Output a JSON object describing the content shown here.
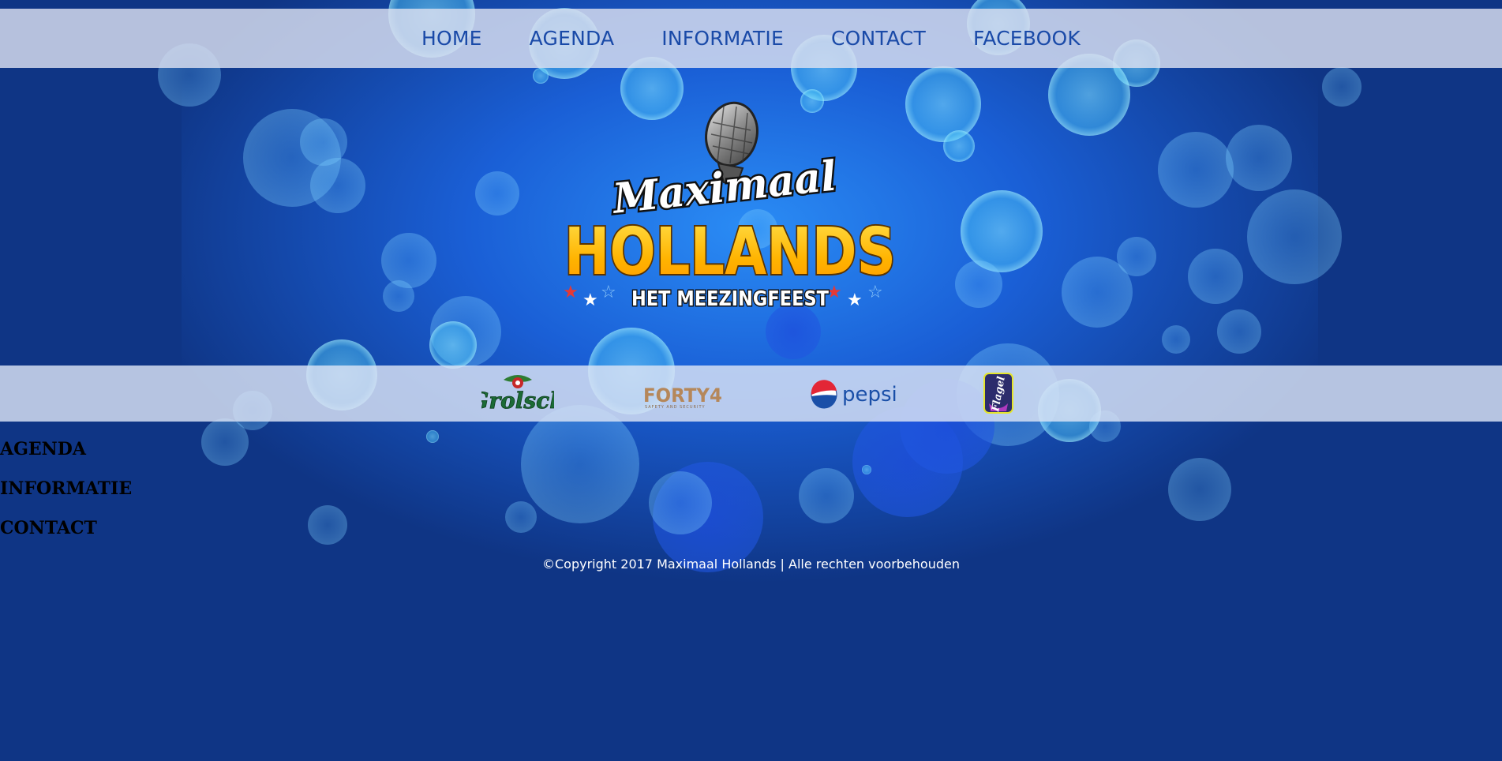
{
  "nav": {
    "items": [
      {
        "label": "HOME"
      },
      {
        "label": "AGENDA"
      },
      {
        "label": "INFORMATIE"
      },
      {
        "label": "CONTACT"
      },
      {
        "label": "FACEBOOK"
      }
    ]
  },
  "logo": {
    "top_line": "Maximaal",
    "main_line": "HOLLANDS",
    "tagline": "HET MEEZINGFEEST",
    "icon": "microphone-icon"
  },
  "sponsors": [
    {
      "name": "Grolsch",
      "icon": "grolsch-logo"
    },
    {
      "name": "FORTY4",
      "subtitle": "SAFETY AND SECURITY",
      "icon": "forty4-logo"
    },
    {
      "name": "pepsi",
      "icon": "pepsi-logo"
    },
    {
      "name": "Flagel",
      "icon": "flagel-logo"
    }
  ],
  "sections": {
    "agenda": "AGENDA",
    "informatie": "INFORMATIE",
    "contact": "CONTACT"
  },
  "footer": {
    "copyright": "©Copyright 2017 Maximaal Hollands | Alle rechten voorbehouden"
  },
  "colors": {
    "background": "#0f3585",
    "nav_text": "#1a4aa8",
    "logo_yellow": "#ffc21a",
    "bar_overlay": "#dce1f0"
  }
}
